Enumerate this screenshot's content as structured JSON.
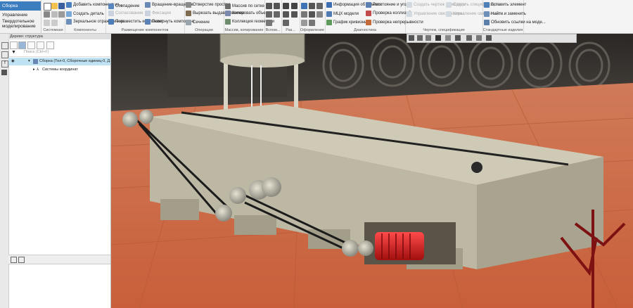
{
  "left_tabs": [
    "Сборка",
    "Управление",
    "Твердотельное моделирование"
  ],
  "groups": [
    {
      "label": "Системная"
    },
    {
      "label": "Компоненты"
    },
    {
      "label": "Размещение компонентов"
    },
    {
      "label": "Операции"
    },
    {
      "label": "Массив, копирование"
    },
    {
      "label": "Вспом..."
    },
    {
      "label": "Раз..."
    },
    {
      "label": "Оформление"
    },
    {
      "label": "Диагностика"
    },
    {
      "label": "Чертеж, спецификация"
    },
    {
      "label": "Стандартные изделия"
    }
  ],
  "buttons": {
    "add_component": "Добавить компонент из...",
    "create_part": "Создать деталь",
    "mirror_component": "Зеркальное отражение ко...",
    "coincidence": "Совпадение",
    "compliance": "Согласование",
    "fixation": "Фиксация",
    "move_component": "Переместить компонент",
    "rotation": "Вращение-вращение",
    "rotate_component": "Повернуть компонент",
    "hole_simple": "Отверстие простое",
    "cut_extrude": "Вырезать выдавливанием",
    "section": "Сечение",
    "array_grid": "Массив по сетке",
    "copy_objects": "Копировать объекты",
    "geometry_collection": "Коллекция геометрии",
    "object_info": "Информация об объекте",
    "mass_props": "МЦХ модели",
    "curvature_graph": "График кривизны",
    "distance_angle": "Расстояние и угол",
    "check_collisions": "Проверка коллизий",
    "check_continuity": "Проверка непрерывности",
    "create_drawing": "Создать чертеж по модели",
    "create_spec": "Создать спецификацию",
    "manage_links": "Управление связанными...",
    "insert_element": "Вставить элемент",
    "find_replace": "Найти и заменить",
    "update_links": "Обновить ссылки на моде..."
  },
  "tree": {
    "title": "Дерево: структура",
    "search_placeholder": "Поиск (Ctrl+F)",
    "items": [
      {
        "label": "Сборка (Тел-0, Сборочные единиц-0, Д..."
      },
      {
        "label": "Системы координат"
      }
    ]
  },
  "colors": {
    "accent": "#3c7dc0",
    "selection": "#bfe3f3",
    "floor": "#c8613a",
    "motor": "#c81d1d",
    "frame": "#bdb8a4"
  }
}
